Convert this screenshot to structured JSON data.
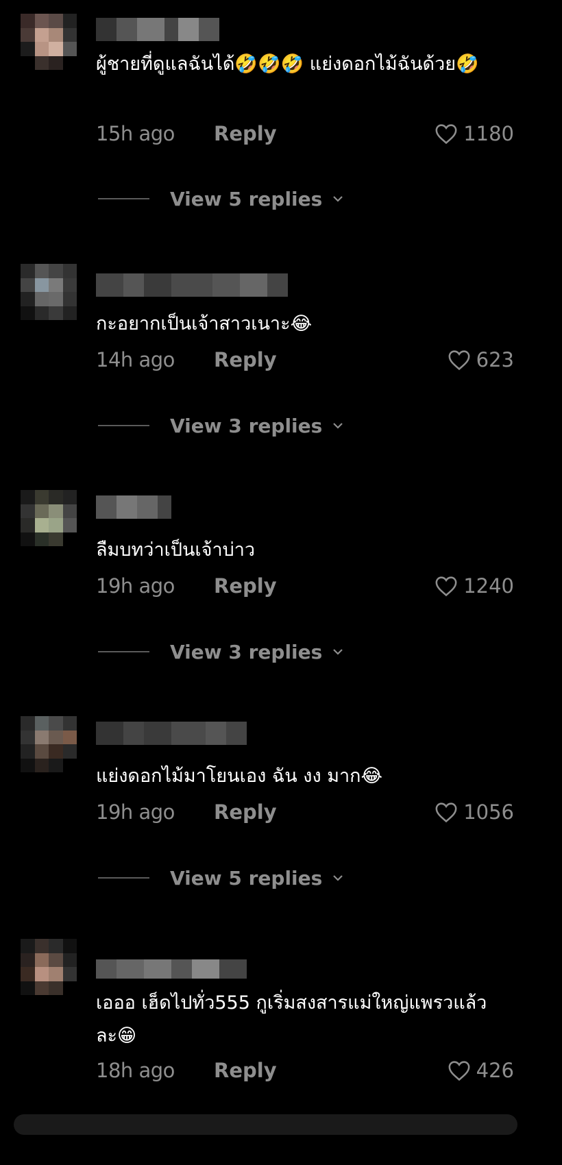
{
  "comments": [
    {
      "text": "ผู้ชายที่ดูแลฉันได้🤣🤣🤣 แย่งดอกไม้ฉันด้วย🤣",
      "time": "15h ago",
      "reply_label": "Reply",
      "likes": "1180",
      "view_replies": "View 5 replies",
      "avatar_icon": "blurred-avatar",
      "username_hidden": true
    },
    {
      "text": "กะอยากเป็นเจ้าสาวเนาะ😂",
      "time": "14h ago",
      "reply_label": "Reply",
      "likes": "623",
      "view_replies": "View 3 replies",
      "avatar_icon": "blurred-avatar",
      "username_hidden": true
    },
    {
      "text": "ลืมบทว่าเป็นเจ้าบ่าว",
      "time": "19h ago",
      "reply_label": "Reply",
      "likes": "1240",
      "view_replies": "View 3 replies",
      "avatar_icon": "blurred-avatar",
      "username_hidden": true
    },
    {
      "text": "แย่งดอกไม้มาโยนเอง ฉัน งง มาก😂",
      "time": "19h ago",
      "reply_label": "Reply",
      "likes": "1056",
      "view_replies": "View 5 replies",
      "avatar_icon": "blurred-avatar",
      "username_hidden": true
    },
    {
      "text": "เอออ เฮ็ดไปทั่ว555 กูเริ่มสงสารแม่ใหญ่แพรวแล้วละ😁",
      "time": "18h ago",
      "reply_label": "Reply",
      "likes": "426",
      "avatar_icon": "blurred-avatar",
      "username_hidden": true
    }
  ],
  "colors": {
    "background": "#000000",
    "text_primary": "#ffffff",
    "text_secondary": "#8e8e8e"
  }
}
